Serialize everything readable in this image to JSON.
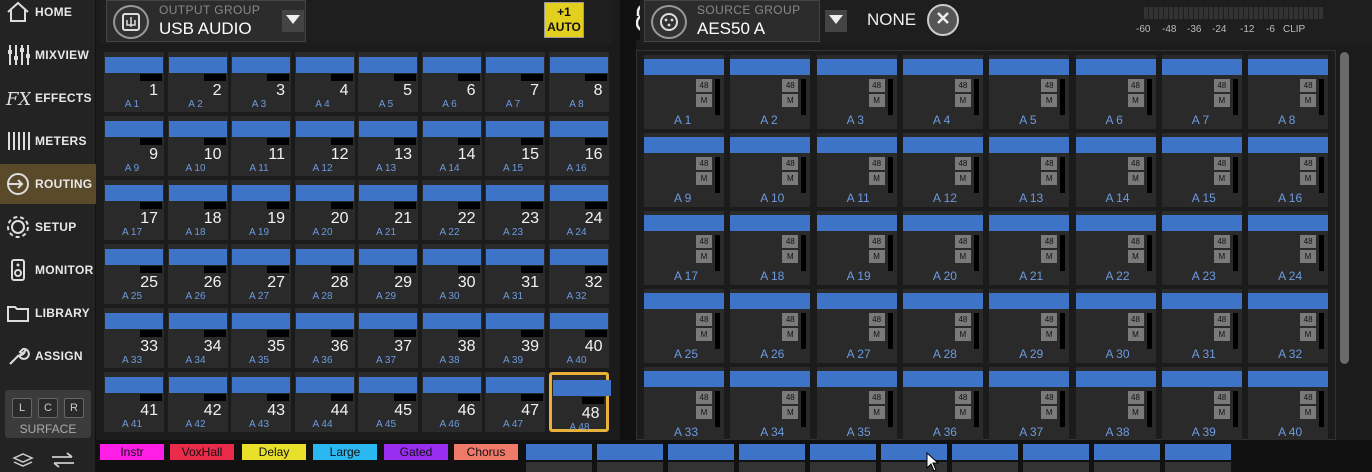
{
  "nav": {
    "items": [
      {
        "label": "HOME",
        "icon": "home-icon"
      },
      {
        "label": "MIXVIEW",
        "icon": "mixview-icon"
      },
      {
        "label": "EFFECTS",
        "icon": "effects-icon"
      },
      {
        "label": "METERS",
        "icon": "meters-icon"
      },
      {
        "label": "ROUTING",
        "icon": "routing-icon",
        "active": true
      },
      {
        "label": "SETUP",
        "icon": "gear-icon"
      },
      {
        "label": "MONITOR",
        "icon": "monitor-icon"
      },
      {
        "label": "LIBRARY",
        "icon": "folder-icon"
      },
      {
        "label": "ASSIGN",
        "icon": "wrench-icon"
      }
    ],
    "surface": {
      "buttons": [
        "L",
        "C",
        "R"
      ],
      "label": "SURFACE"
    }
  },
  "output": {
    "caption": "OUTPUT GROUP",
    "value": "USB AUDIO",
    "auto_line1": "+1",
    "auto_line2": "AUTO",
    "selected_channel": "48",
    "channels": [
      {
        "num": "1",
        "src": "A 1"
      },
      {
        "num": "2",
        "src": "A 2"
      },
      {
        "num": "3",
        "src": "A 3"
      },
      {
        "num": "4",
        "src": "A 4"
      },
      {
        "num": "5",
        "src": "A 5"
      },
      {
        "num": "6",
        "src": "A 6"
      },
      {
        "num": "7",
        "src": "A 7"
      },
      {
        "num": "8",
        "src": "A 8"
      },
      {
        "num": "9",
        "src": "A 9"
      },
      {
        "num": "10",
        "src": "A 10"
      },
      {
        "num": "11",
        "src": "A 11"
      },
      {
        "num": "12",
        "src": "A 12"
      },
      {
        "num": "13",
        "src": "A 13"
      },
      {
        "num": "14",
        "src": "A 14"
      },
      {
        "num": "15",
        "src": "A 15"
      },
      {
        "num": "16",
        "src": "A 16"
      },
      {
        "num": "17",
        "src": "A 17"
      },
      {
        "num": "18",
        "src": "A 18"
      },
      {
        "num": "19",
        "src": "A 19"
      },
      {
        "num": "20",
        "src": "A 20"
      },
      {
        "num": "21",
        "src": "A 21"
      },
      {
        "num": "22",
        "src": "A 22"
      },
      {
        "num": "23",
        "src": "A 23"
      },
      {
        "num": "24",
        "src": "A 24"
      },
      {
        "num": "25",
        "src": "A 25"
      },
      {
        "num": "26",
        "src": "A 26"
      },
      {
        "num": "27",
        "src": "A 27"
      },
      {
        "num": "28",
        "src": "A 28"
      },
      {
        "num": "29",
        "src": "A 29"
      },
      {
        "num": "30",
        "src": "A 30"
      },
      {
        "num": "31",
        "src": "A 31"
      },
      {
        "num": "32",
        "src": "A 32"
      },
      {
        "num": "33",
        "src": "A 33"
      },
      {
        "num": "34",
        "src": "A 34"
      },
      {
        "num": "35",
        "src": "A 35"
      },
      {
        "num": "36",
        "src": "A 36"
      },
      {
        "num": "37",
        "src": "A 37"
      },
      {
        "num": "38",
        "src": "A 38"
      },
      {
        "num": "39",
        "src": "A 39"
      },
      {
        "num": "40",
        "src": "A 40"
      },
      {
        "num": "41",
        "src": "A 41"
      },
      {
        "num": "42",
        "src": "A 42"
      },
      {
        "num": "43",
        "src": "A 43"
      },
      {
        "num": "44",
        "src": "A 44"
      },
      {
        "num": "45",
        "src": "A 45"
      },
      {
        "num": "46",
        "src": "A 46"
      },
      {
        "num": "47",
        "src": "A 47"
      },
      {
        "num": "48",
        "src": "A 48"
      }
    ]
  },
  "source": {
    "caption": "SOURCE GROUP",
    "value": "AES50 A",
    "none_label": "NONE",
    "badge_48": "48",
    "badge_m": "M",
    "meter_scale": [
      "-60",
      "-48",
      "-36",
      "-24",
      "-12",
      "-6",
      "CLIP"
    ],
    "channels": [
      "A 1",
      "A 2",
      "A 3",
      "A 4",
      "A 5",
      "A 6",
      "A 7",
      "A 8",
      "A 9",
      "A 10",
      "A 11",
      "A 12",
      "A 13",
      "A 14",
      "A 15",
      "A 16",
      "A 17",
      "A 18",
      "A 19",
      "A 20",
      "A 21",
      "A 22",
      "A 23",
      "A 24",
      "A 25",
      "A 26",
      "A 27",
      "A 28",
      "A 29",
      "A 30",
      "A 31",
      "A 32",
      "A 33",
      "A 34",
      "A 35",
      "A 36",
      "A 37",
      "A 38",
      "A 39",
      "A 40"
    ]
  },
  "bottom": {
    "tags": [
      {
        "label": "Instr",
        "color": "#ff1ee6"
      },
      {
        "label": "VoxHall",
        "color": "#ea2b4a"
      },
      {
        "label": "Delay",
        "color": "#e8e02a"
      },
      {
        "label": "Large",
        "color": "#2ab8f0"
      },
      {
        "label": "Gated",
        "color": "#9a2ef0"
      },
      {
        "label": "Chorus",
        "color": "#f07a6a"
      }
    ]
  }
}
